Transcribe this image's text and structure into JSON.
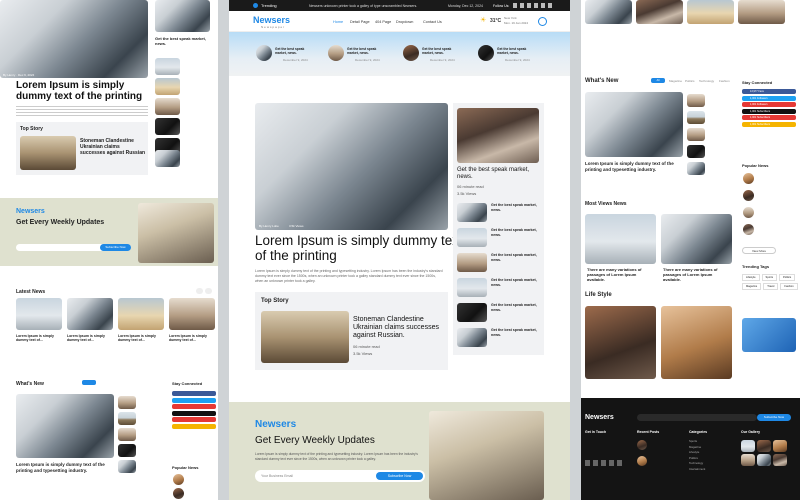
{
  "header": {
    "trending_label": "Trending",
    "trending_text": "Newsers unknown printer took a galley of type unscrambled Newsers.",
    "date_text": "Monday, Dec 12, 2024",
    "follow_label": "Follow Us:"
  },
  "brand": {
    "logo": "Newsers",
    "tagline": "Newspaper"
  },
  "nav": {
    "items": [
      "Home",
      "Detail Page",
      "404 Page",
      "Dropdown",
      "Contact Us"
    ],
    "weather_temp": "31°C",
    "weather_city": "New York",
    "weather_date": "Mon. 19 Jan 2024"
  },
  "ticker": {
    "items": [
      {
        "text": "Get the best speak market, news.",
        "date": "December 9, 2024"
      },
      {
        "text": "Get the best speak market, news.",
        "date": "December 9, 2024"
      },
      {
        "text": "Get the best speak market, news.",
        "date": "December 9, 2024"
      },
      {
        "text": "Get the best speak market, news.",
        "date": "December 9, 2024"
      }
    ]
  },
  "hero": {
    "headline": "Lorem Ipsum is simply dummy text of the printing",
    "body": "Lorem Ipsum is simply dummy text of the printing and typesetting industry. Lorem Ipsum has been the industry's standard dummy text ever since the 1500s, when an unknown printer took a galley standard dummy text ever since the 1500s, when an unknown printer took a galley.",
    "author_meta": "By Henry Lobe",
    "views_meta": "3.5k Views"
  },
  "side_feature": {
    "title": "Get the best speak market, news.",
    "meta1": "06 minute read",
    "meta2": "3.5k Views"
  },
  "side_list": [
    "Get the best speak market, news.",
    "Get the best speak market, news.",
    "Get the best speak market, news.",
    "Get the best speak market, news.",
    "Get the best speak market, news.",
    "Get the best speak market, news."
  ],
  "top_story": {
    "section": "Top Story",
    "title": "Stoneman Clandestine Ukrainian claims successes against Russian.",
    "meta1": "06 minute read",
    "meta2": "3.5k Views"
  },
  "newsletter": {
    "brand": "Newsers",
    "title": "Get Every Weekly Updates",
    "body": "Lorem Ipsum is simply dummy text of the printing and typesetting industry. Lorem Ipsum has been the industry's standard dummy text ever since the 1500s, when an unknown printer took a galley.",
    "placeholder": "Your Business Email",
    "button": "Subscribe Now"
  },
  "left_col": {
    "headline": "Lorem Ipsum is simply dummy text of the printing",
    "top_story": "Top Story",
    "top_story_title": "Stoneman Clandestine Ukrainian claims successes against Russian",
    "side_item": "Get the best speak market, news.",
    "latest_news": "Latest News",
    "latest_caption": "Lorem Ipsum is simply dummy text of...",
    "whats_new": "What's New",
    "feature_caption": "Lorem Ipsum is simply dummy text of the printing and typesetting industry.",
    "stay_connected": "Stay Connected",
    "popular_news": "Popular News"
  },
  "right_col": {
    "whats_new": "What's New",
    "tabs": [
      "All",
      "Magazine",
      "Politics",
      "Technology",
      "Fashion"
    ],
    "feature_caption": "Lorem Ipsum is simply dummy text of the printing and typesetting industry.",
    "stay_connected": "Stay Connected",
    "social": [
      {
        "label": "13,977 Fans",
        "color": "#3b5998"
      },
      {
        "label": "1,001 Followers",
        "color": "#1da1f2"
      },
      {
        "label": "1,001 Followers",
        "color": "#e53935"
      },
      {
        "label": "1,001 Subscribers",
        "color": "#111111"
      },
      {
        "label": "1,001 Subscribers",
        "color": "#e53935"
      },
      {
        "label": "1,001 Subscribers",
        "color": "#f5b400"
      }
    ],
    "popular_news": "Popular News",
    "view_more": "View More",
    "most_views": "Most Views News",
    "most_views_caption": "There are many variations of passages of Lorem Ipsum available.",
    "trending_tags": "Trending Tags",
    "tags": [
      "Lifestyle",
      "Sports",
      "Politics",
      "Magazine",
      "Travel",
      "Fashion"
    ],
    "life_style": "Life Style",
    "footer_logo": "Newsers",
    "footer_cols": [
      "Get In Touch",
      "Recent Posts",
      "Categories",
      "Our Gallery"
    ],
    "categories": [
      "Sports",
      "Magazine",
      "Lifestyle",
      "Politics",
      "Technology",
      "Intertainment"
    ],
    "subscribe_btn": "Subscribe Now"
  }
}
